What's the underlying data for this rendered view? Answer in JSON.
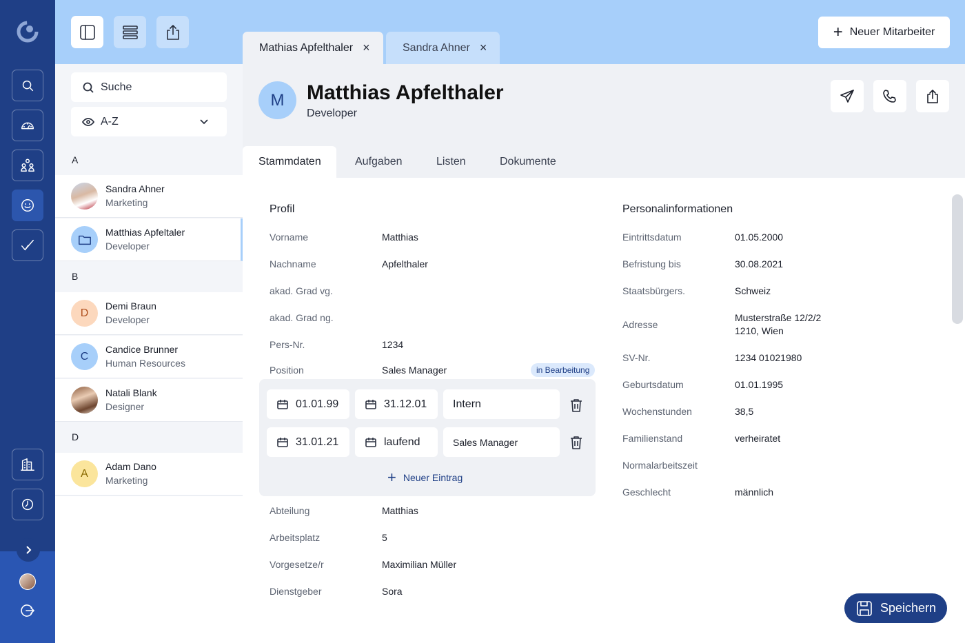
{
  "colors": {
    "rail": "#1f3f86",
    "topbar": "#a7cffa",
    "accent": "#1f3f86",
    "badge_bg": "#dbe9fc"
  },
  "rail": {
    "items": [
      {
        "icon": "search-icon"
      },
      {
        "icon": "dashboard-gauge-icon"
      },
      {
        "icon": "team-icon"
      },
      {
        "icon": "smiley-icon",
        "active": true
      },
      {
        "icon": "checkmark-icon"
      },
      {
        "icon": "building-icon"
      },
      {
        "icon": "clock-icon"
      }
    ]
  },
  "toolbar": {
    "icons": [
      "sidebar-layout-icon",
      "list-layout-icon",
      "share-icon"
    ]
  },
  "tabs": [
    {
      "label": "Mathias Apfelthaler",
      "close": "×",
      "active": true
    },
    {
      "label": "Sandra Ahner",
      "close": "×",
      "active": false
    }
  ],
  "new_employee_button": {
    "label": "Neuer Mitarbeiter",
    "icon": "plus-icon"
  },
  "search": {
    "placeholder": "Suche"
  },
  "sort": {
    "value": "A-Z"
  },
  "list": {
    "groups": [
      {
        "letter": "A",
        "people": [
          {
            "name": "Sandra Ahner",
            "role": "Marketing",
            "avatar": "photo"
          },
          {
            "name": "Matthias Apfeltaler",
            "role": "Developer",
            "avatar": "folder-icon",
            "selected": true
          }
        ]
      },
      {
        "letter": "B",
        "people": [
          {
            "name": "Demi Braun",
            "role": "Developer",
            "avatar": "D"
          },
          {
            "name": "Candice Brunner",
            "role": "Human Resources",
            "avatar": "C"
          },
          {
            "name": "Natali Blank",
            "role": "Designer",
            "avatar": "photo"
          }
        ]
      },
      {
        "letter": "D",
        "people": [
          {
            "name": "Adam Dano",
            "role": "Marketing",
            "avatar": "A"
          }
        ]
      }
    ]
  },
  "detail": {
    "initial": "M",
    "name": "Matthias Apfelthaler",
    "role": "Developer",
    "actions": [
      "send-icon",
      "phone-icon",
      "share-icon"
    ],
    "tabs": [
      "Stammdaten",
      "Aufgaben",
      "Listen",
      "Dokumente"
    ],
    "profile": {
      "title": "Profil",
      "rows": [
        {
          "label": "Vorname",
          "value": "Matthias"
        },
        {
          "label": "Nachname",
          "value": "Apfelthaler"
        },
        {
          "label": "akad. Grad vg.",
          "value": ""
        },
        {
          "label": "akad. Grad ng.",
          "value": ""
        },
        {
          "label": "Pers-Nr.",
          "value": "1234"
        },
        {
          "label": "Position",
          "value": "Sales Manager",
          "badge": "in Bearbeitung"
        }
      ],
      "position_entries": [
        {
          "from": "01.01.99",
          "to": "31.12.01",
          "type": "Intern"
        },
        {
          "from": "31.01.21",
          "to": "laufend",
          "type": "Sales Manager"
        }
      ],
      "new_entry_label": "Neuer Eintrag",
      "rows_after": [
        {
          "label": "Abteilung",
          "value": "Matthias"
        },
        {
          "label": "Arbeitsplatz",
          "value": "5"
        },
        {
          "label": "Vorgesetze/r",
          "value": "Maximilian Müller"
        },
        {
          "label": "Dienstgeber",
          "value": "Sora"
        }
      ]
    },
    "personal": {
      "title": "Personalinformationen",
      "rows": [
        {
          "label": "Eintrittsdatum",
          "value": "01.05.2000"
        },
        {
          "label": "Befristung bis",
          "value": "30.08.2021"
        },
        {
          "label": "Staatsbürgers.",
          "value": "Schweiz"
        },
        {
          "label": "Adresse",
          "value": "Musterstraße 12/2/2",
          "value2": "1210, Wien"
        },
        {
          "label": "SV-Nr.",
          "value": "1234 01021980"
        },
        {
          "label": "Geburtsdatum",
          "value": "01.01.1995"
        },
        {
          "label": "Wochenstunden",
          "value": "38,5"
        },
        {
          "label": "Familienstand",
          "value": "verheiratet"
        },
        {
          "label": "Normalarbeitszeit",
          "value": ""
        },
        {
          "label": "Geschlecht",
          "value": "männlich"
        }
      ]
    }
  },
  "save_button": {
    "label": "Speichern",
    "icon": "save-icon"
  }
}
